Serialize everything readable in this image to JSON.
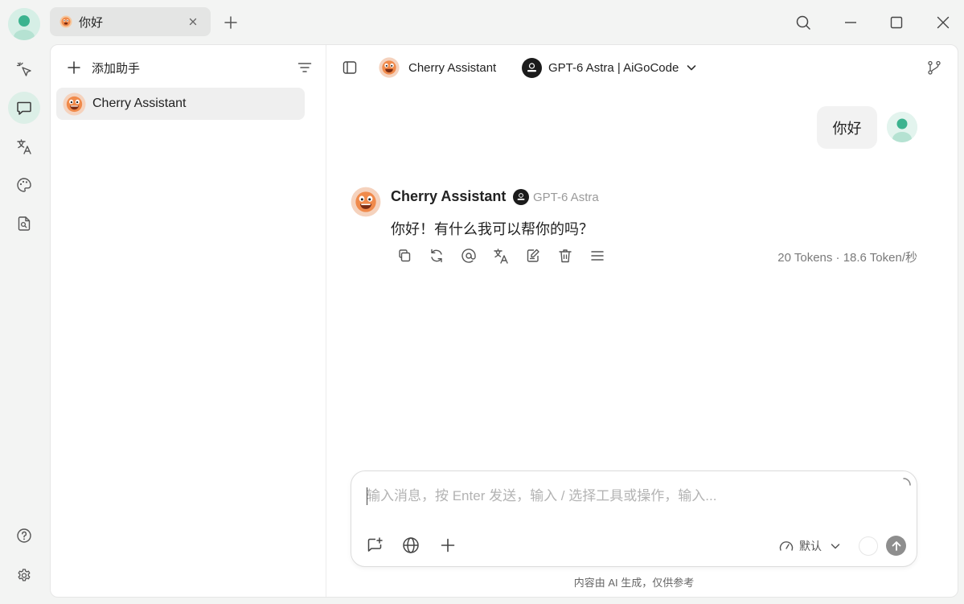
{
  "tabs": [
    {
      "title": "你好",
      "icon": "cherry-emoji-icon"
    }
  ],
  "window_controls": [
    "search-icon",
    "minimize-icon",
    "maximize-icon",
    "close-icon"
  ],
  "left_rail": [
    "sparkle-pointer-icon",
    "chat-icon",
    "translate-icon",
    "palette-icon",
    "file-search-icon",
    "help-icon",
    "settings-icon"
  ],
  "assistants_panel": {
    "add_label": "添加助手",
    "items": [
      {
        "name": "Cherry Assistant",
        "selected": true
      }
    ]
  },
  "chat_header": {
    "assistant_name": "Cherry Assistant",
    "model_name": "GPT-6 Astra | AiGoCode"
  },
  "messages": [
    {
      "role": "user",
      "text": "你好"
    },
    {
      "role": "assistant",
      "name": "Cherry Assistant",
      "model": "GPT-6 Astra",
      "text": "你好！有什么我可以帮你的吗？",
      "token_info": "20 Tokens · 18.6 Token/秒"
    }
  ],
  "composer": {
    "placeholder": "输入消息，按 Enter 发送，输入 / 选择工具或操作，输入...",
    "think_mode": "默认"
  },
  "disclaimer": "内容由 AI 生成，仅供参考",
  "colors": {
    "accent_green": "#3cb38f",
    "active_rail_bg": "#dcefe7",
    "send_button": "#8e8e8e"
  }
}
